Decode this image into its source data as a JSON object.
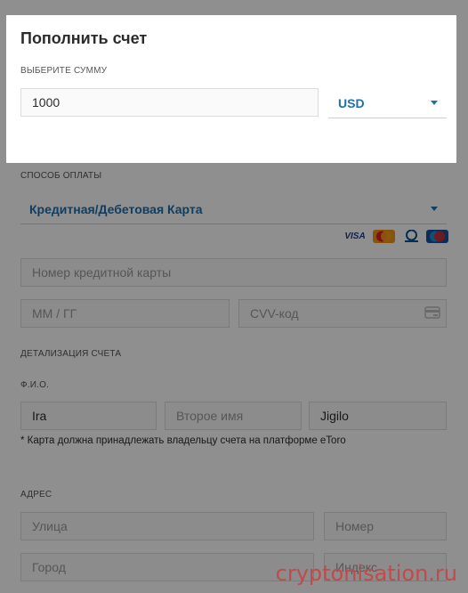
{
  "modal": {
    "title": "Пополнить счет",
    "amount_label": "ВЫБЕРИТЕ СУММУ",
    "amount_value": "1000",
    "currency": "USD"
  },
  "payment": {
    "label": "СПОСОБ ОПЛАТЫ",
    "method": "Кредитная/Дебетовая Карта",
    "card_logos": [
      "VISA",
      "MasterCard",
      "Diners Club International",
      "Maestro"
    ],
    "card_number_placeholder": "Номер кредитной карты",
    "expiry_placeholder": "ММ / ГГ",
    "cvv_placeholder": "CVV-код"
  },
  "account": {
    "label": "ДЕТАЛИЗАЦИЯ СЧЕТА",
    "name_label": "Ф.И.О.",
    "first_name": "Ira",
    "middle_name_placeholder": "Второе имя",
    "last_name": "Jigilo",
    "note": "* Карта должна принадлежать владельцу счета на платформе eToro"
  },
  "address": {
    "label": "АДРЕС",
    "street_placeholder": "Улица",
    "number_placeholder": "Номер",
    "city_placeholder": "Город",
    "zip_placeholder": "Индекс"
  },
  "watermark": "cryptonisation.ru",
  "colors": {
    "accent": "#1c6fb0",
    "overlay": "#000000",
    "watermark": "#c24a4a"
  }
}
